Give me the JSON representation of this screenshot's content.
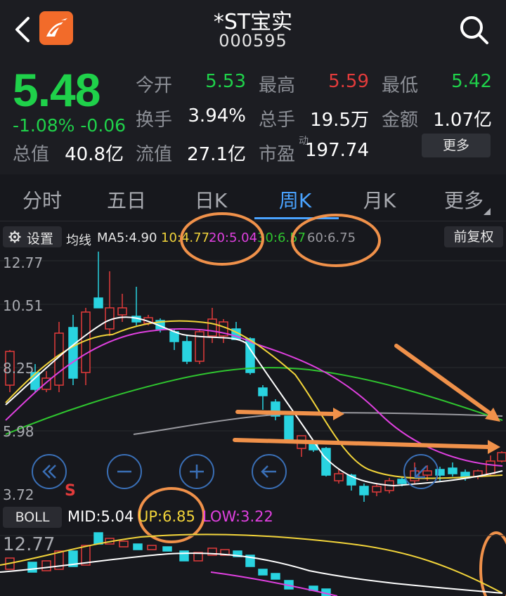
{
  "header": {
    "title": "*ST宝实",
    "code": "000595"
  },
  "quote": {
    "price": "5.48",
    "change": "-1.08% -0.06",
    "fields": [
      {
        "label": "今开",
        "value": "5.53",
        "color": "#1fd14a"
      },
      {
        "label": "最高",
        "value": "5.59",
        "color": "#e23b3b"
      },
      {
        "label": "最低",
        "value": "5.42",
        "color": "#1fd14a"
      },
      {
        "label": "换手",
        "value": "3.94%",
        "color": "#ffffff"
      },
      {
        "label": "总手",
        "value": "19.5万",
        "color": "#ffffff"
      },
      {
        "label": "金额",
        "value": "1.07亿",
        "color": "#ffffff"
      },
      {
        "label": "总值",
        "value": "40.8亿",
        "color": "#ffffff"
      },
      {
        "label": "流值",
        "value": "27.1亿",
        "color": "#ffffff"
      },
      {
        "label": "市盈",
        "value": "197.74",
        "color": "#ffffff",
        "superscript": "动"
      }
    ],
    "more_label": "更多"
  },
  "tabs": [
    "分时",
    "五日",
    "日K",
    "周K",
    "月K",
    "更多"
  ],
  "active_tab": "周K",
  "ma_bar": {
    "settings_label": "设置",
    "items": [
      {
        "text": "均线",
        "color": "#e6e6e6"
      },
      {
        "text": "MA5:4.90",
        "color": "#e6e6e6"
      },
      {
        "text": "10:4.77",
        "color": "#f2d43a"
      },
      {
        "text": "20:5.04",
        "color": "#e040e0"
      },
      {
        "text": "30:6.57",
        "color": "#2fc52f"
      },
      {
        "text": "60:6.75",
        "color": "#9a9aa0"
      }
    ],
    "adjust_label": "前复权"
  },
  "y_axis": [
    "12.77",
    "10.51",
    "8.25",
    "5.98",
    "3.72"
  ],
  "marker_s": "S",
  "controls": [
    "rewind-icon",
    "zoom-out-icon",
    "zoom-in-icon",
    "back-arrow-icon",
    "reset-icon"
  ],
  "boll": {
    "button": "BOLL",
    "items": [
      {
        "text": "MID:5.04",
        "color": "#ffffff"
      },
      {
        "text": "UP:6.85",
        "color": "#f2d43a"
      },
      {
        "text": "LOW:3.22",
        "color": "#e040e0"
      }
    ],
    "top_label": "12.77"
  },
  "colors": {
    "up": "#e23b3b",
    "down": "#29d3e0",
    "accent": "#4aa3ff",
    "annotation": "#f0914a"
  }
}
